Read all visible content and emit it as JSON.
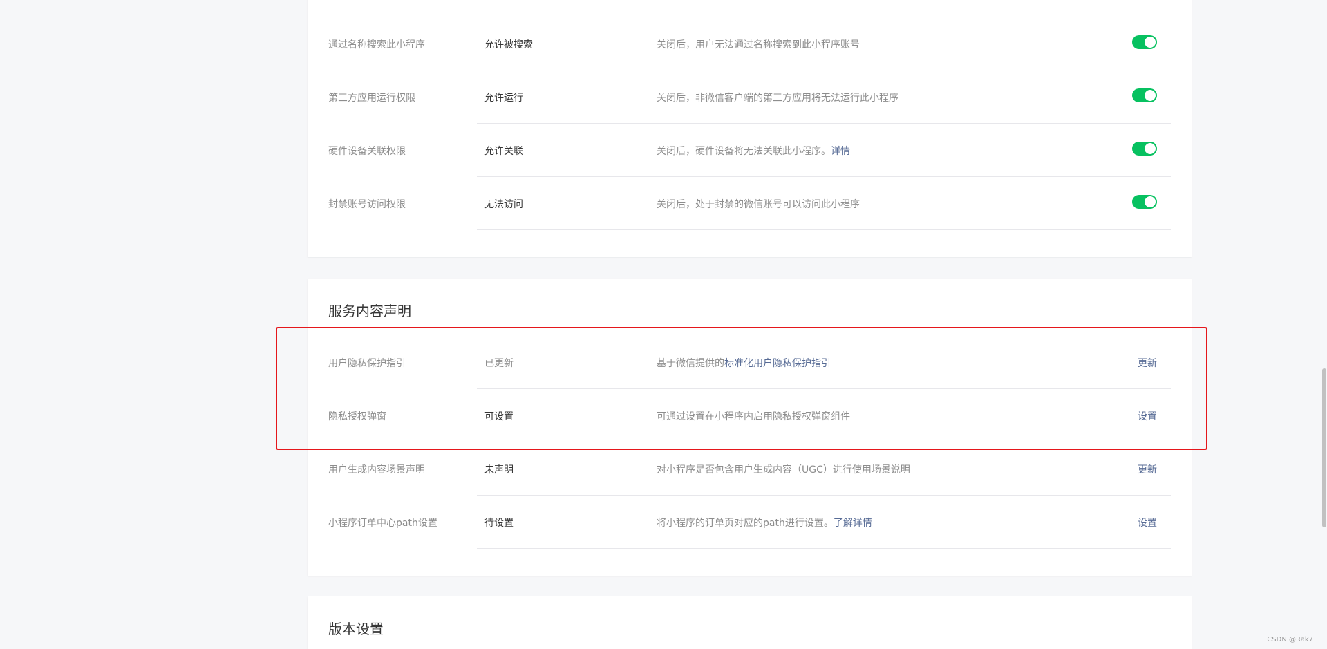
{
  "privacy_section": {
    "rows": [
      {
        "label": "通过名称搜索此小程序",
        "status": "允许被搜索",
        "description": "关闭后，用户无法通过名称搜索到此小程序账号",
        "desc_link": "",
        "toggle": true
      },
      {
        "label": "第三方应用运行权限",
        "status": "允许运行",
        "description": "关闭后，非微信客户端的第三方应用将无法运行此小程序",
        "desc_link": "",
        "toggle": true
      },
      {
        "label": "硬件设备关联权限",
        "status": "允许关联",
        "description": "关闭后，硬件设备将无法关联此小程序。",
        "desc_link": "详情",
        "toggle": true
      },
      {
        "label": "封禁账号访问权限",
        "status": "无法访问",
        "description": "关闭后，处于封禁的微信账号可以访问此小程序",
        "desc_link": "",
        "toggle": true
      }
    ]
  },
  "service_section": {
    "title": "服务内容声明",
    "rows": [
      {
        "label": "用户隐私保护指引",
        "status": "已更新",
        "description": "基于微信提供的",
        "desc_link": "标准化用户隐私保护指引",
        "action": "更新"
      },
      {
        "label": "隐私授权弹窗",
        "status": "可设置",
        "description": "可通过设置在小程序内启用隐私授权弹窗组件",
        "desc_link": "",
        "action": "设置"
      },
      {
        "label": "用户生成内容场景声明",
        "status": "未声明",
        "description": "对小程序是否包含用户生成内容（UGC）进行使用场景说明",
        "desc_link": "",
        "action": "更新"
      },
      {
        "label": "小程序订单中心path设置",
        "status": "待设置",
        "description": "将小程序的订单页对应的path进行设置。",
        "desc_link": "了解详情",
        "action": "设置"
      }
    ]
  },
  "version_section": {
    "title": "版本设置"
  },
  "watermark": "CSDN @Rak7",
  "colors": {
    "toggle_on": "#07c160",
    "link": "#576b95",
    "highlight": "#e5171c"
  }
}
